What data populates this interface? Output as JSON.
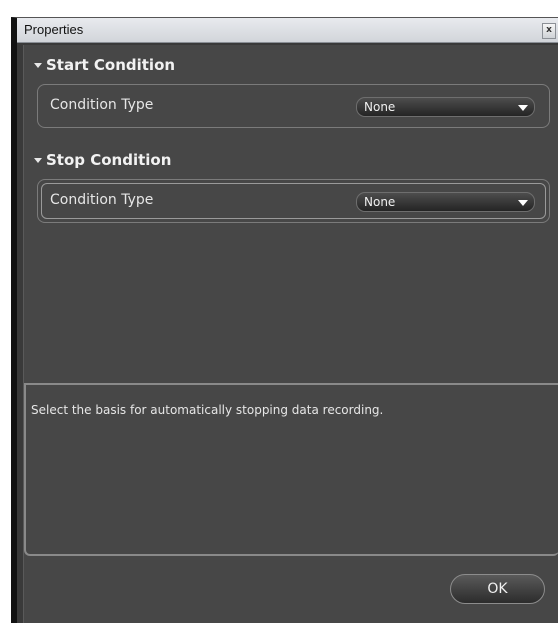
{
  "window": {
    "title": "Properties",
    "close_glyph": "x"
  },
  "start_condition": {
    "header": "Start Condition",
    "row_label": "Condition Type",
    "selected_value": "None"
  },
  "stop_condition": {
    "header": "Stop Condition",
    "row_label": "Condition Type",
    "selected_value": "None"
  },
  "description": {
    "text": "Select the basis for automatically stopping data recording."
  },
  "footer": {
    "ok_label": "OK"
  },
  "icons": {
    "section_toggle": "triangle-down-icon",
    "dropdown": "chevron-down-icon",
    "close": "close-icon"
  }
}
